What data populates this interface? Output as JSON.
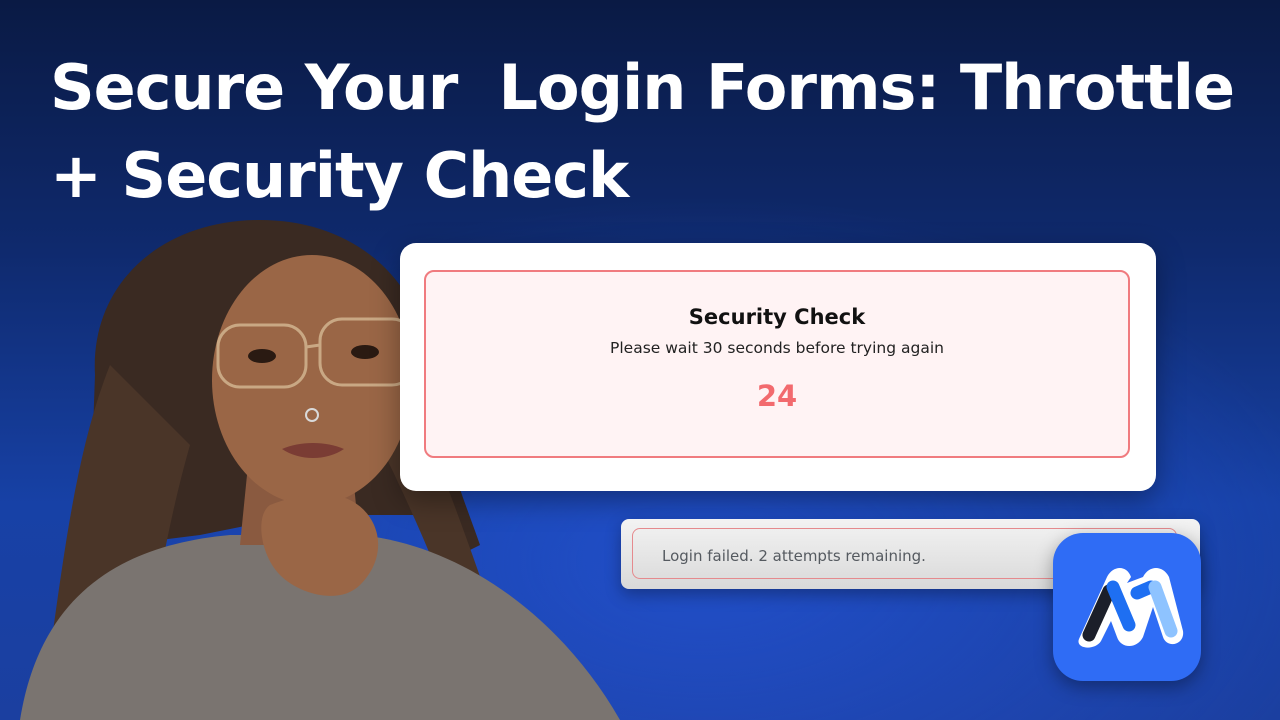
{
  "headline": {
    "line1": "Secure Your  Login Forms: Throttle",
    "line2": "+ Security Check"
  },
  "security_card": {
    "title": "Security Check",
    "message": "Please wait 30 seconds before trying again",
    "countdown": "24",
    "accent_color": "#f26a6e"
  },
  "alert": {
    "message": "Login failed. 2 attempts remaining."
  },
  "logo": {
    "icon": "brand-m-logo-icon",
    "tile_color": "#2f6cf5"
  },
  "presenter": {
    "icon": "presenter-photo"
  }
}
